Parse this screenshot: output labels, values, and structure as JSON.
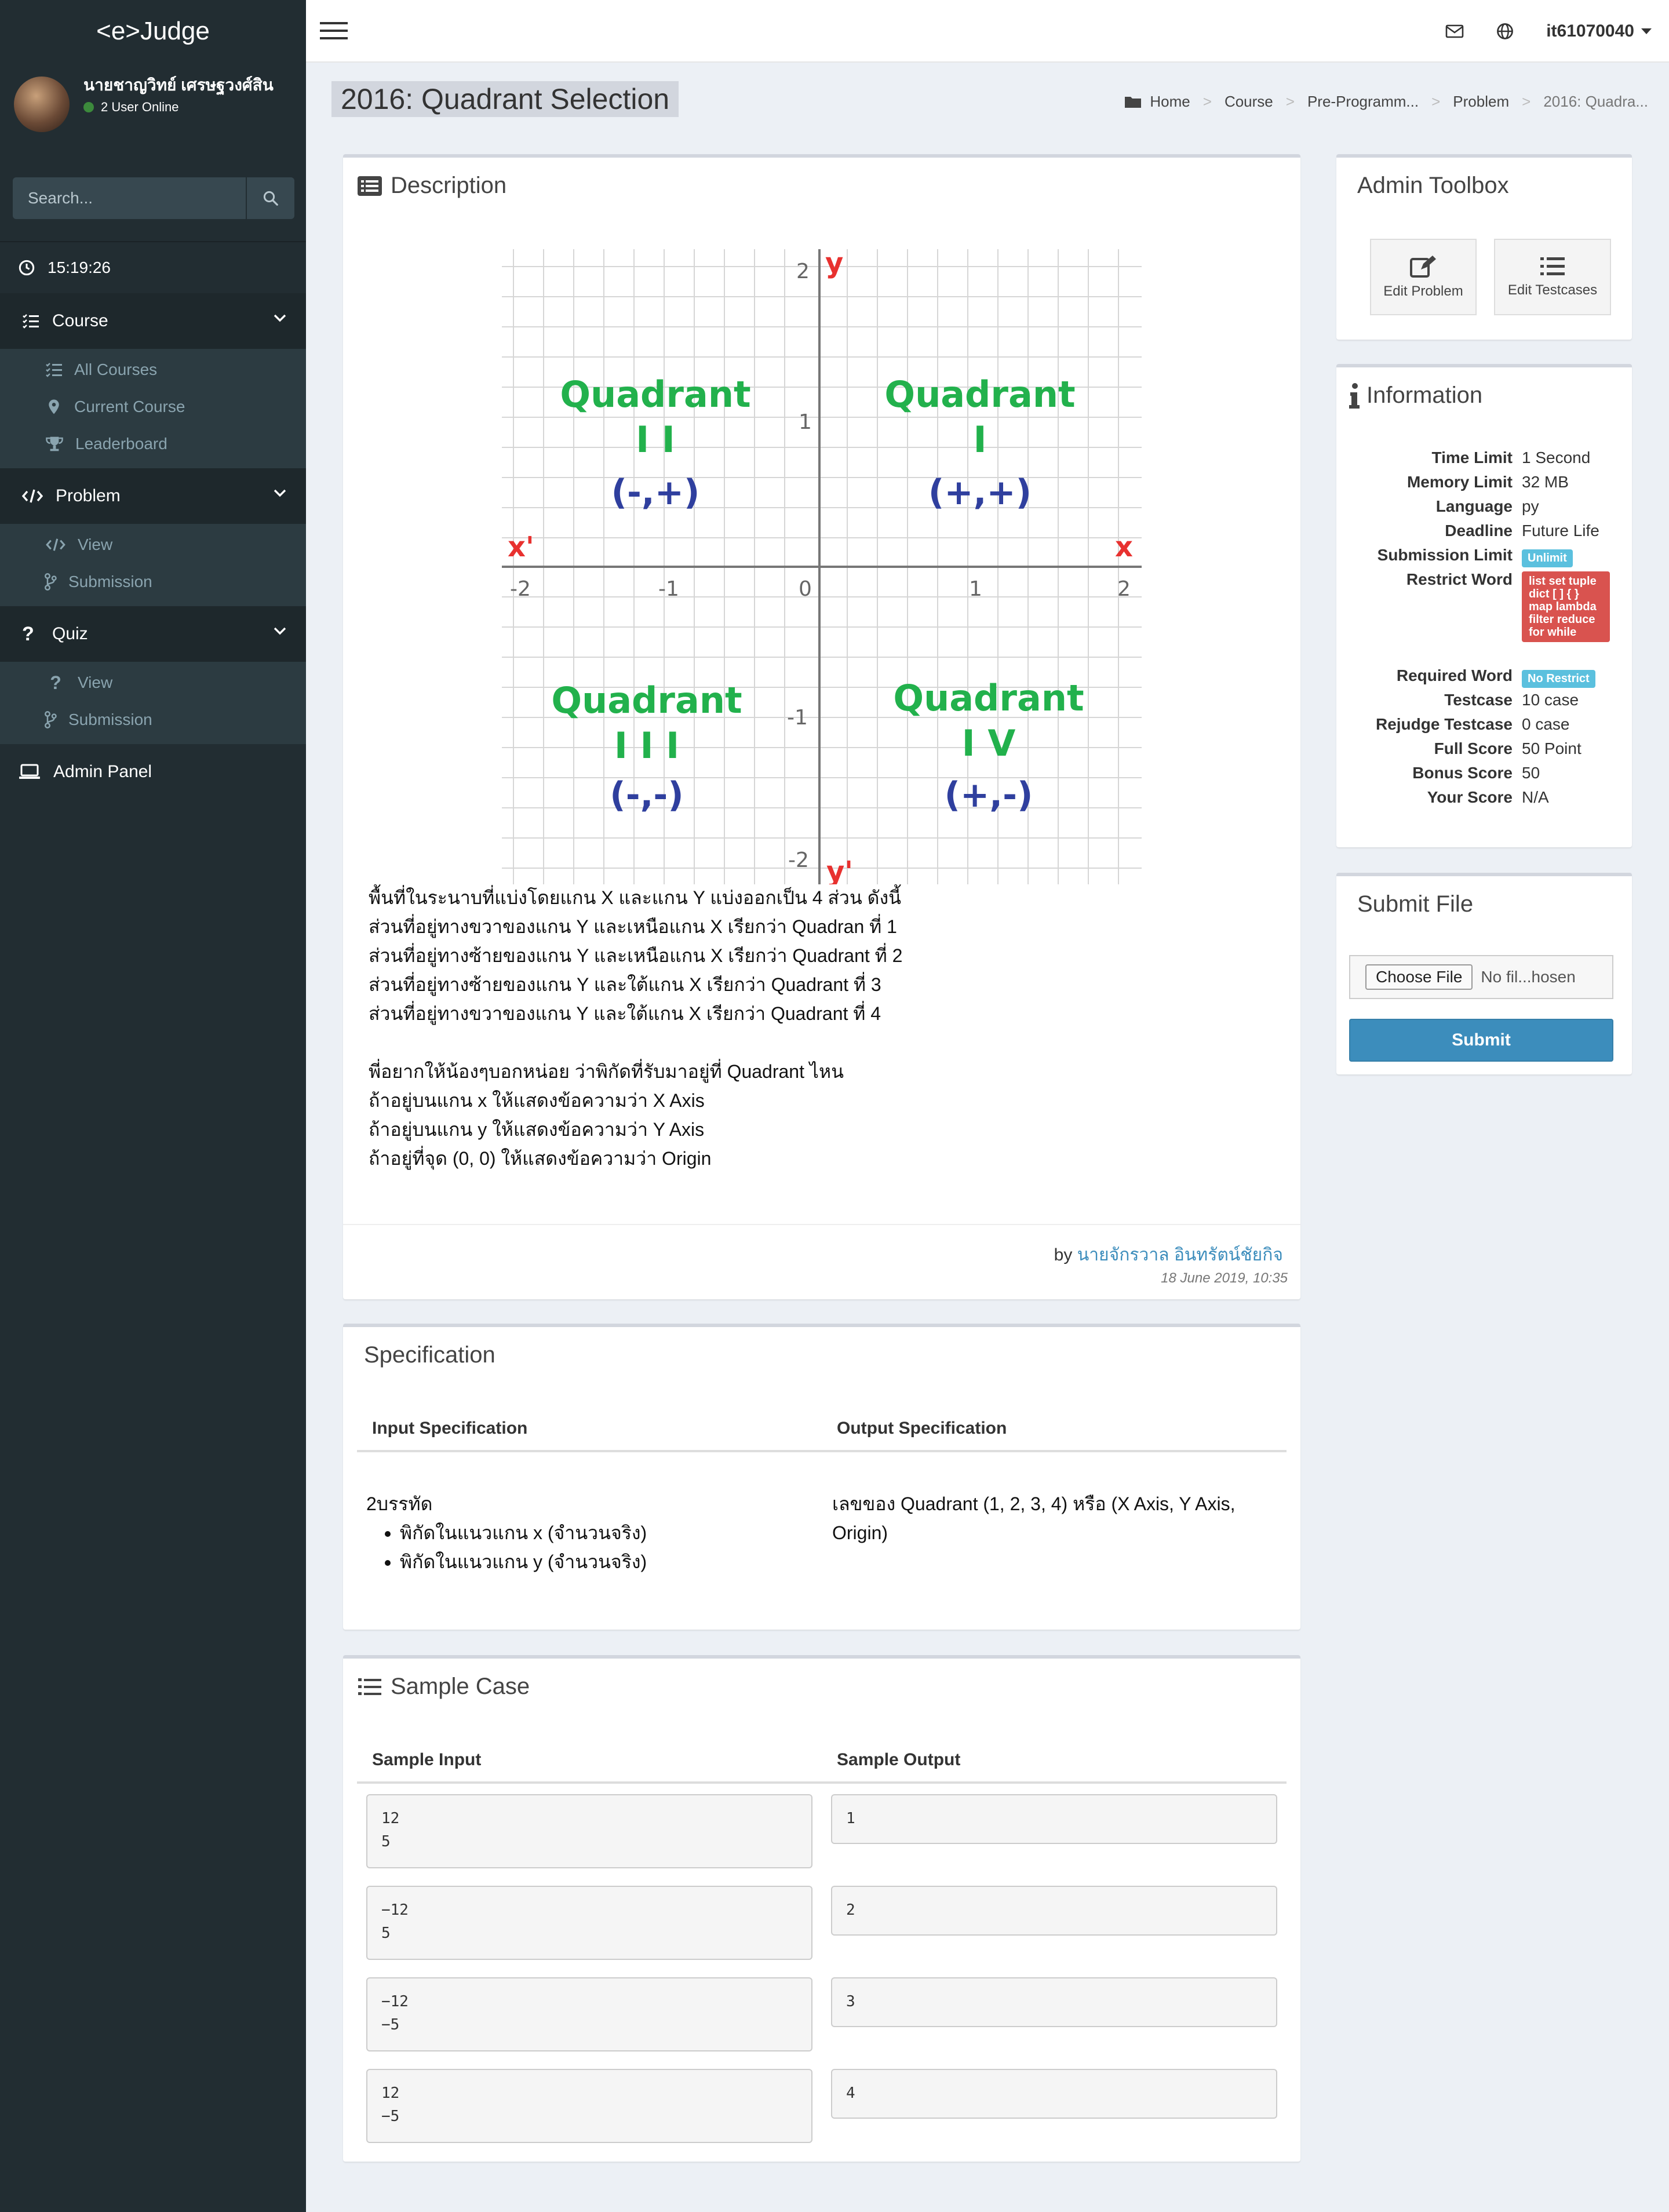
{
  "app": {
    "logo": "<e>Judge"
  },
  "user": {
    "name": "นายชาญวิทย์ เศรษฐวงศ์สิน",
    "status": "2 User Online",
    "username": "it61070040"
  },
  "sidebar": {
    "search_placeholder": "Search...",
    "clock": "15:19:26",
    "course": {
      "label": "Course",
      "items": [
        "All Courses",
        "Current Course",
        "Leaderboard"
      ]
    },
    "problem": {
      "label": "Problem",
      "items": [
        "View",
        "Submission"
      ]
    },
    "quiz": {
      "label": "Quiz",
      "items": [
        "View",
        "Submission"
      ]
    },
    "admin": "Admin Panel"
  },
  "page": {
    "title": "2016: Quadrant Selection",
    "breadcrumb": [
      "Home",
      "Course",
      "Pre-Programm...",
      "Problem",
      "2016: Quadra..."
    ]
  },
  "description": {
    "heading": "Description",
    "image_labels": {
      "y_top": "2",
      "y_top_axis": "y",
      "y_one": "1",
      "y_zero": "0",
      "y_minus_one": "-1",
      "y_minus_two": "-2",
      "y_bottom_axis": "y'",
      "x_left_axis": "x'",
      "x_right_axis": "x",
      "x_ticks": [
        "-2",
        "-1",
        "1",
        "2"
      ],
      "q1": [
        "Quadrant",
        "I",
        "(+,+)"
      ],
      "q2": [
        "Quadrant",
        "I I",
        "(-,+)"
      ],
      "q3": [
        "Quadrant",
        "I I I",
        "(-,-)"
      ],
      "q4": [
        "Quadrant",
        "I V",
        "(+,-)"
      ]
    },
    "lines": [
      "พื้นที่ในระนาบที่แบ่งโดยแกน X และแกน Y แบ่งออกเป็น 4 ส่วน ดังนี้",
      "ส่วนที่อยู่ทางขวาของแกน Y และเหนือแกน X เรียกว่า Quadran ที่ 1",
      "ส่วนที่อยู่ทางซ้ายของแกน Y และเหนือแกน X เรียกว่า Quadrant ที่ 2",
      "ส่วนที่อยู่ทางซ้ายของแกน Y และใต้แกน X เรียกว่า Quadrant ที่ 3",
      "ส่วนที่อยู่ทางขวาของแกน Y และใต้แกน X เรียกว่า Quadrant ที่ 4",
      "",
      "พี่อยากให้น้องๆบอกหน่อย ว่าพิกัดที่รับมาอยู่ที่ Quadrant ไหน",
      "ถ้าอยู่บนแกน x ให้แสดงข้อความว่า X Axis",
      "ถ้าอยู่บนแกน y ให้แสดงข้อความว่า Y Axis",
      "ถ้าอยู่ที่จุด (0, 0) ให้แสดงข้อความว่า Origin"
    ],
    "by_prefix": "by",
    "author": "นายจักรวาล อินทรัตน์ชัยกิจ",
    "date": "18 June 2019, 10:35"
  },
  "specification": {
    "heading": "Specification",
    "input_header": "Input Specification",
    "output_header": "Output Specification",
    "input_intro": "2บรรทัด",
    "input_items": [
      "พิกัดในแนวแกน x (จำนวนจริง)",
      "พิกัดในแนวแกน y (จำนวนจริง)"
    ],
    "output_line1": "เลขของ Quadrant (1, 2, 3, 4) หรือ (X Axis, Y Axis,",
    "output_line2": "Origin)"
  },
  "samples": {
    "heading": "Sample Case",
    "input_header": "Sample Input",
    "output_header": "Sample Output",
    "cases": [
      {
        "input": "12\n5",
        "output": "1"
      },
      {
        "input": "−12\n5",
        "output": "2"
      },
      {
        "input": "−12\n−5",
        "output": "3"
      },
      {
        "input": "12\n−5",
        "output": "4"
      }
    ]
  },
  "toolbox": {
    "heading": "Admin Toolbox",
    "edit_problem": "Edit Problem",
    "edit_testcases": "Edit Testcases"
  },
  "information": {
    "heading": "Information",
    "time_limit": {
      "label": "Time Limit",
      "value": "1 Second"
    },
    "memory_limit": {
      "label": "Memory Limit",
      "value": "32 MB"
    },
    "language": {
      "label": "Language",
      "value": "py"
    },
    "deadline": {
      "label": "Deadline",
      "value": "Future Life"
    },
    "submission_limit": {
      "label": "Submission Limit",
      "value": "Unlimit"
    },
    "restrict_word": {
      "label": "Restrict Word",
      "value": "list set tuple dict [ ] { } map lambda filter reduce for while"
    },
    "required_word": {
      "label": "Required Word",
      "value": "No Restrict"
    },
    "testcase": {
      "label": "Testcase",
      "value": "10 case"
    },
    "rejudge_testcase": {
      "label": "Rejudge Testcase",
      "value": "0 case"
    },
    "full_score": {
      "label": "Full Score",
      "value": "50 Point"
    },
    "bonus_score": {
      "label": "Bonus Score",
      "value": "50"
    },
    "your_score": {
      "label": "Your Score",
      "value": "N/A"
    }
  },
  "submit_file": {
    "heading": "Submit File",
    "choose_label": "Choose File",
    "file_status": "No fil...hosen",
    "submit_label": "Submit"
  },
  "colors": {
    "sidebar": "#222d32",
    "accent": "#3c8dbc",
    "badge_blue": "#5bc0de",
    "badge_red": "#d9534f",
    "quadrant_green": "#22b14c",
    "quadrant_blue": "#2f3f9e",
    "axis_red": "#e8312f"
  }
}
